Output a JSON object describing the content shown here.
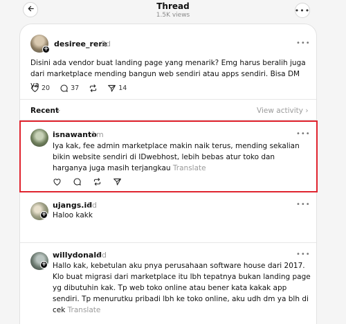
{
  "header": {
    "title": "Thread",
    "views": "1.5K views"
  },
  "icons": {
    "back": "arrow-left-icon",
    "more": "more-horizontal-icon"
  },
  "colors": {
    "highlight": "#e0232e"
  },
  "post": {
    "username": "desiree_rere",
    "time": "2d",
    "text": "Disini ada vendor buat landing page yang menarik? Emg harus beralih juga dari marketplace mending bangun web sendiri atau apps sendiri. Bisa DM ya",
    "likes": "20",
    "replies": "37",
    "shares": "14"
  },
  "sort": {
    "label": "Recent",
    "view_activity": "View activity"
  },
  "replies": [
    {
      "username": "isnawanto",
      "time": "1m",
      "text": "Iya kak, fee admin marketplace makin naik terus, mending sekalian bikin website sendiri di IDwebhost, lebih bebas atur toko dan harganya juga masih terjangkau",
      "translate": "Translate"
    },
    {
      "username": "ujangs.id",
      "time": "1d",
      "text": "Haloo kakk"
    },
    {
      "username": "willydonald",
      "time": "1d",
      "text": "Hallo kak, kebetulan aku pnya perusahaan software house dari 2017. Klo buat migrasi dari marketplace itu lbh tepatnya bukan landing page yg dibutuhin kak. Tp web toko online atau bener kata kakak app sendiri. Tp menurutku pribadi lbh ke toko online, aku udh dm ya blh di cek",
      "translate": "Translate"
    }
  ]
}
